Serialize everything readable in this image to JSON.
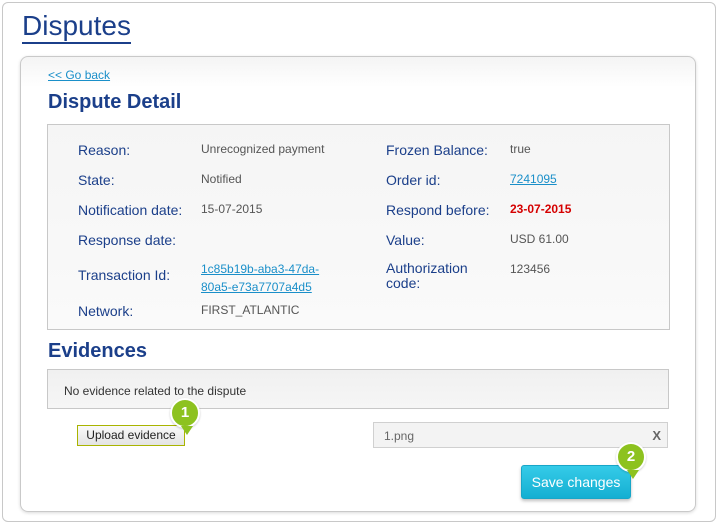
{
  "page": {
    "title": "Disputes"
  },
  "nav": {
    "back_label": "<< Go back"
  },
  "detail": {
    "title": "Dispute Detail",
    "reason_label": "Reason:",
    "reason_value": "Unrecognized payment",
    "state_label": "State:",
    "state_value": "Notified",
    "notification_date_label": "Notification date:",
    "notification_date_value": "15-07-2015",
    "response_date_label": "Response date:",
    "response_date_value": "",
    "transaction_id_label": "Transaction Id:",
    "transaction_id_line1": "1c85b19b-aba3-47da-",
    "transaction_id_line2": "80a5-e73a7707a4d5",
    "network_label": "Network:",
    "network_value": "FIRST_ATLANTIC",
    "frozen_balance_label": "Frozen Balance:",
    "frozen_balance_value": "true",
    "order_id_label": "Order id:",
    "order_id_value": "7241095",
    "respond_before_label": "Respond before:",
    "respond_before_value": "23-07-2015",
    "value_label": "Value:",
    "value_value": "USD 61.00",
    "authorization_code_label_line1": "Authorization",
    "authorization_code_label_line2": "code:",
    "authorization_code_value": "123456"
  },
  "evidences": {
    "title": "Evidences",
    "empty_message": "No evidence related to the dispute",
    "upload_label": "Upload evidence",
    "file_name": "1.png",
    "remove_label": "X",
    "save_label": "Save changes"
  },
  "callouts": {
    "one": "1",
    "two": "2"
  },
  "colors": {
    "title_blue": "#1b3f8a",
    "link_blue": "#1a8fc9",
    "deadline_red": "#d50000",
    "save_cyan": "#14afd2",
    "callout_green": "#8dc21f"
  }
}
